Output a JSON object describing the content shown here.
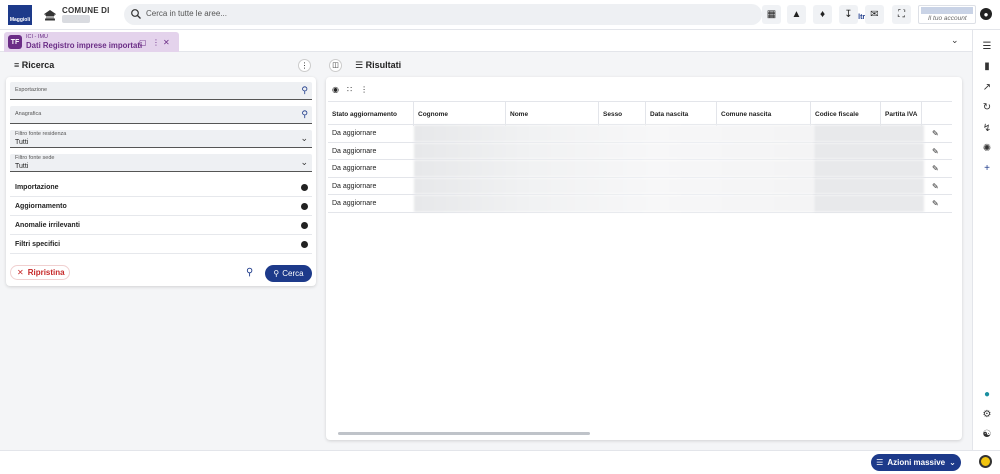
{
  "header": {
    "comune_label": "COMUNE DI",
    "logo_text": "Maggioli",
    "search_placeholder": "Cerca in tutte le aree...",
    "filter_label": "Filtra",
    "user_subtitle": "Il tuo account",
    "icons": [
      "apps-grid-icon",
      "warning-icon",
      "bell-icon",
      "download-icon",
      "mail-icon",
      "fullscreen-icon",
      "user-icon"
    ]
  },
  "tab": {
    "badge": "TF",
    "subtitle": "ICI - IMU",
    "title": "Dati Registro imprese importati"
  },
  "ricerca": {
    "title": "Ricerca",
    "fields": [
      {
        "label": "Esportazione",
        "value": ""
      },
      {
        "label": "Anagrafica",
        "value": ""
      },
      {
        "label": "Filtro fonte residenza",
        "value": "Tutti"
      },
      {
        "label": "Filtro fonte sede",
        "value": "Tutti"
      }
    ],
    "sections": [
      "Importazione",
      "Aggiornamento",
      "Anomalie irrilevanti",
      "Filtri specifici"
    ],
    "reset_label": "Ripristina",
    "search_label": "Cerca"
  },
  "risultati": {
    "title": "Risultati",
    "columns": [
      "Stato aggiornamento",
      "Cognome",
      "Nome",
      "Sesso",
      "Data nascita",
      "Comune nascita",
      "Codice fiscale",
      "Partita IVA"
    ],
    "rows": [
      {
        "stato": "Da aggiornare"
      },
      {
        "stato": "Da aggiornare"
      },
      {
        "stato": "Da aggiornare"
      },
      {
        "stato": "Da aggiornare"
      },
      {
        "stato": "Da aggiornare"
      }
    ]
  },
  "footer": {
    "azioni_label": "Azioni massive"
  }
}
